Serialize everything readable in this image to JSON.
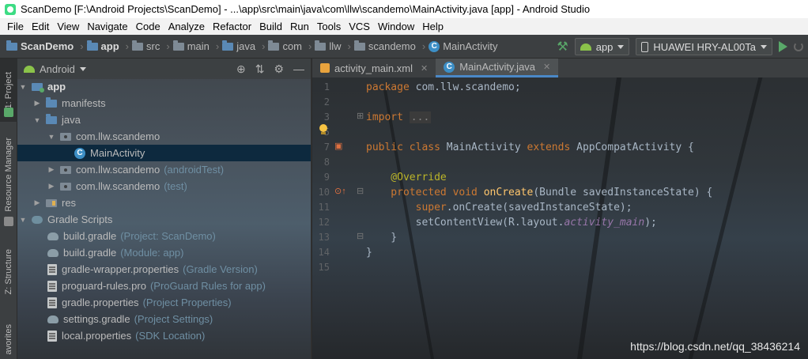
{
  "window": {
    "title": "ScanDemo [F:\\Android Projects\\ScanDemo] - ...\\app\\src\\main\\java\\com\\llw\\scandemo\\MainActivity.java [app] - Android Studio"
  },
  "menu": [
    "File",
    "Edit",
    "View",
    "Navigate",
    "Code",
    "Analyze",
    "Refactor",
    "Build",
    "Run",
    "Tools",
    "VCS",
    "Window",
    "Help"
  ],
  "breadcrumbs": [
    "ScanDemo",
    "app",
    "src",
    "main",
    "java",
    "com",
    "llw",
    "scandemo",
    "MainActivity"
  ],
  "toolbar": {
    "config": "app",
    "device": "HUAWEI HRY-AL00Ta"
  },
  "left_strip": {
    "project_tab": "1: Project",
    "resource_tab": "Resource Manager",
    "structure_tab": "Z: Structure",
    "favorites_tab": "avorites"
  },
  "project": {
    "view_mode": "Android",
    "tree": [
      {
        "label": "app",
        "hint": ""
      },
      {
        "label": "manifests",
        "hint": ""
      },
      {
        "label": "java",
        "hint": ""
      },
      {
        "label": "com.llw.scandemo",
        "hint": ""
      },
      {
        "label": "MainActivity",
        "hint": ""
      },
      {
        "label": "com.llw.scandemo",
        "hint": "(androidTest)"
      },
      {
        "label": "com.llw.scandemo",
        "hint": "(test)"
      },
      {
        "label": "res",
        "hint": ""
      },
      {
        "label": "Gradle Scripts",
        "hint": ""
      },
      {
        "label": "build.gradle",
        "hint": "(Project: ScanDemo)"
      },
      {
        "label": "build.gradle",
        "hint": "(Module: app)"
      },
      {
        "label": "gradle-wrapper.properties",
        "hint": "(Gradle Version)"
      },
      {
        "label": "proguard-rules.pro",
        "hint": "(ProGuard Rules for app)"
      },
      {
        "label": "gradle.properties",
        "hint": "(Project Properties)"
      },
      {
        "label": "settings.gradle",
        "hint": "(Project Settings)"
      },
      {
        "label": "local.properties",
        "hint": "(SDK Location)"
      }
    ]
  },
  "editor": {
    "tabs": [
      "activity_main.xml",
      "MainActivity.java"
    ],
    "line_numbers": [
      "1",
      "2",
      "3",
      "5",
      "7",
      "8",
      "9",
      "10",
      "11",
      "12",
      "13",
      "14",
      "15"
    ],
    "code": {
      "l1_kw": "package",
      "l1_rest": " com.llw.scandemo;",
      "l3_kw": "import",
      "l3_fold": "...",
      "l7_kw1": "public class",
      "l7_name": " MainActivity ",
      "l7_kw2": "extends",
      "l7_rest": " AppCompatActivity {",
      "l9_ann": "    @Override",
      "l10_kw": "    protected void",
      "l10_fn": " onCreate",
      "l10_rest": "(Bundle savedInstanceState) {",
      "l11_kw": "        super",
      "l11_rest": ".onCreate(savedInstanceState);",
      "l12_a": "        setContentView(R.layout.",
      "l12_it": "activity_main",
      "l12_b": ");",
      "l13": "    }",
      "l14": "}"
    }
  },
  "watermark": "https://blog.csdn.net/qq_38436214",
  "colors": {
    "keyword": "#cc7832",
    "annotation": "#bbb529",
    "function": "#ffc66d",
    "field": "#9876aa",
    "default_text": "#a9b7c6",
    "selection": "#0d293e"
  }
}
